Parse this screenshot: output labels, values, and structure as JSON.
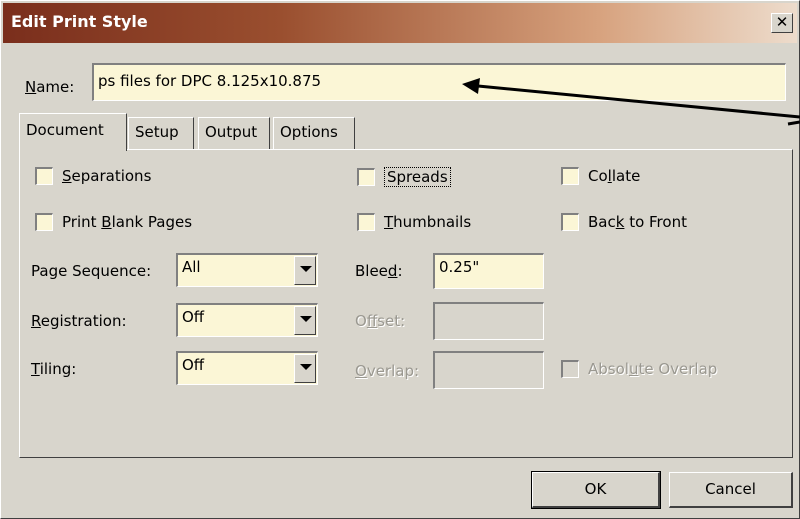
{
  "window": {
    "title": "Edit Print Style",
    "close_glyph": "✕"
  },
  "name_field": {
    "label_u": "N",
    "label_rest": "ame:",
    "value": "ps files for DPC 8.125x10.875"
  },
  "tabs": [
    {
      "label": "Document",
      "active": true
    },
    {
      "label": "Setup",
      "active": false
    },
    {
      "label": "Output",
      "active": false
    },
    {
      "label": "Options",
      "active": false
    }
  ],
  "document": {
    "separations": {
      "u": "S",
      "rest": "eparations",
      "checked": false
    },
    "print_blank_pages": {
      "pre": "Print ",
      "u": "B",
      "rest": "lank Pages",
      "checked": false
    },
    "spreads": {
      "label": "Spreads",
      "checked": false
    },
    "thumbnails": {
      "u": "T",
      "rest": "humbnails",
      "checked": false
    },
    "collate": {
      "pre": "Co",
      "u": "l",
      "rest": "late",
      "checked": false
    },
    "back_to_front": {
      "pre": "Bac",
      "u": "k",
      "rest": " to Front",
      "checked": false
    },
    "page_sequence": {
      "label": "Page Sequence:",
      "value": "All"
    },
    "registration": {
      "u": "R",
      "rest": "egistration:",
      "value": "Off"
    },
    "tiling": {
      "u": "T",
      "rest": "iling:",
      "value": "Off"
    },
    "bleed": {
      "pre": "Blee",
      "u": "d",
      "rest": ":",
      "value": "0.25\""
    },
    "offset": {
      "pre": "O",
      "u": "f",
      "rest": "fset:",
      "value": ""
    },
    "overlap": {
      "u": "O",
      "rest": "verlap:",
      "value": ""
    },
    "absolute_overlap": {
      "pre": "Absol",
      "u": "u",
      "rest": "te Overlap",
      "checked": false
    }
  },
  "buttons": {
    "ok": "OK",
    "cancel": "Cancel"
  },
  "colors": {
    "field_bg": "#fbf6d6",
    "dialog_bg": "#d8d5cc",
    "title_start": "#7a2e1c"
  }
}
